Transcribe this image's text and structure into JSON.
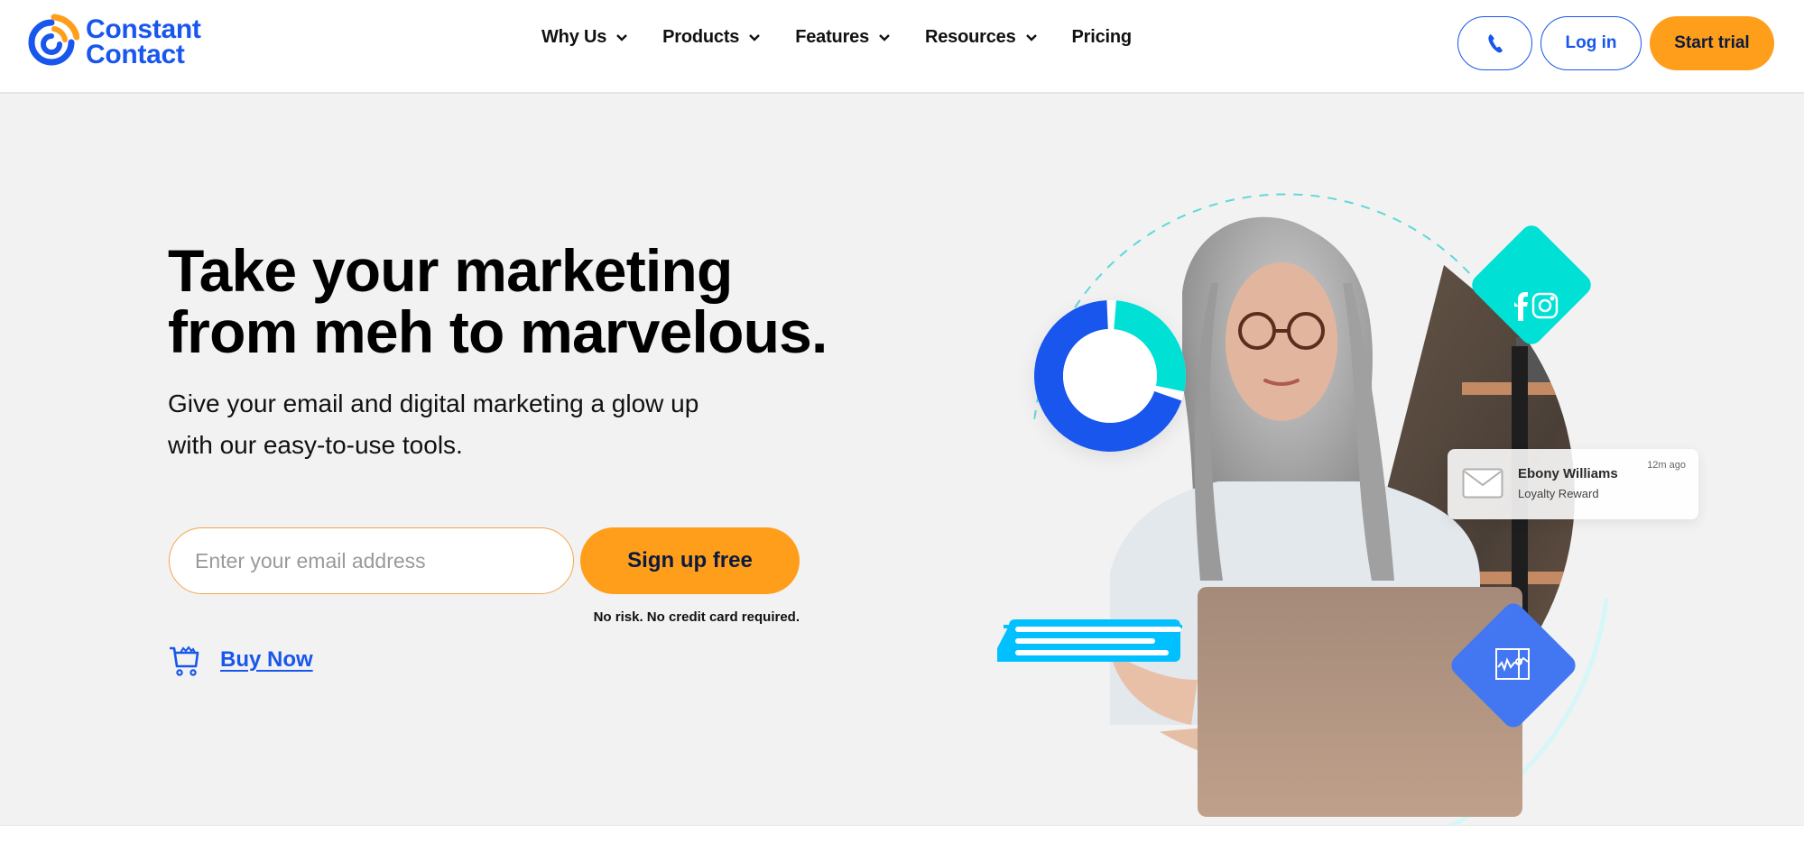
{
  "brand": {
    "name_line1": "Constant",
    "name_line2": "Contact",
    "colors": {
      "primary_blue": "#1856ed",
      "orange": "#ff9e1b",
      "teal": "#00e0d5",
      "sky": "#00c0ff",
      "hero_bg": "#f2f2f2"
    }
  },
  "nav": {
    "items": [
      {
        "label": "Why Us",
        "has_dropdown": true
      },
      {
        "label": "Products",
        "has_dropdown": true
      },
      {
        "label": "Features",
        "has_dropdown": true
      },
      {
        "label": "Resources",
        "has_dropdown": true
      },
      {
        "label": "Pricing",
        "has_dropdown": false
      }
    ]
  },
  "header_actions": {
    "phone_icon": "phone-icon",
    "login_label": "Log in",
    "trial_label": "Start trial"
  },
  "hero": {
    "title_line1": "Take your marketing",
    "title_line2": "from meh to marvelous.",
    "subtitle_line1": "Give your email and digital marketing a glow up",
    "subtitle_line2": "with our easy-to-use tools.",
    "email_placeholder": "Enter your email address",
    "email_value": "",
    "signup_label": "Sign up free",
    "disclaimer": "No risk. No credit card required.",
    "buy_now_label": "Buy Now",
    "buy_now_icon": "shopping-cart-icon"
  },
  "illustration": {
    "notification": {
      "name": "Ebony Williams",
      "subject": "Loyalty Reward",
      "time": "12m ago",
      "icon": "envelope-icon"
    },
    "social_badge_icons": [
      "facebook-icon",
      "instagram-icon"
    ],
    "analytics_badge_icon": "line-chart-icon",
    "donut_segments": [
      {
        "name": "teal",
        "fraction": 0.27,
        "color": "#00e0d5"
      },
      {
        "name": "blue",
        "fraction": 0.69,
        "color": "#1856ed"
      }
    ]
  }
}
